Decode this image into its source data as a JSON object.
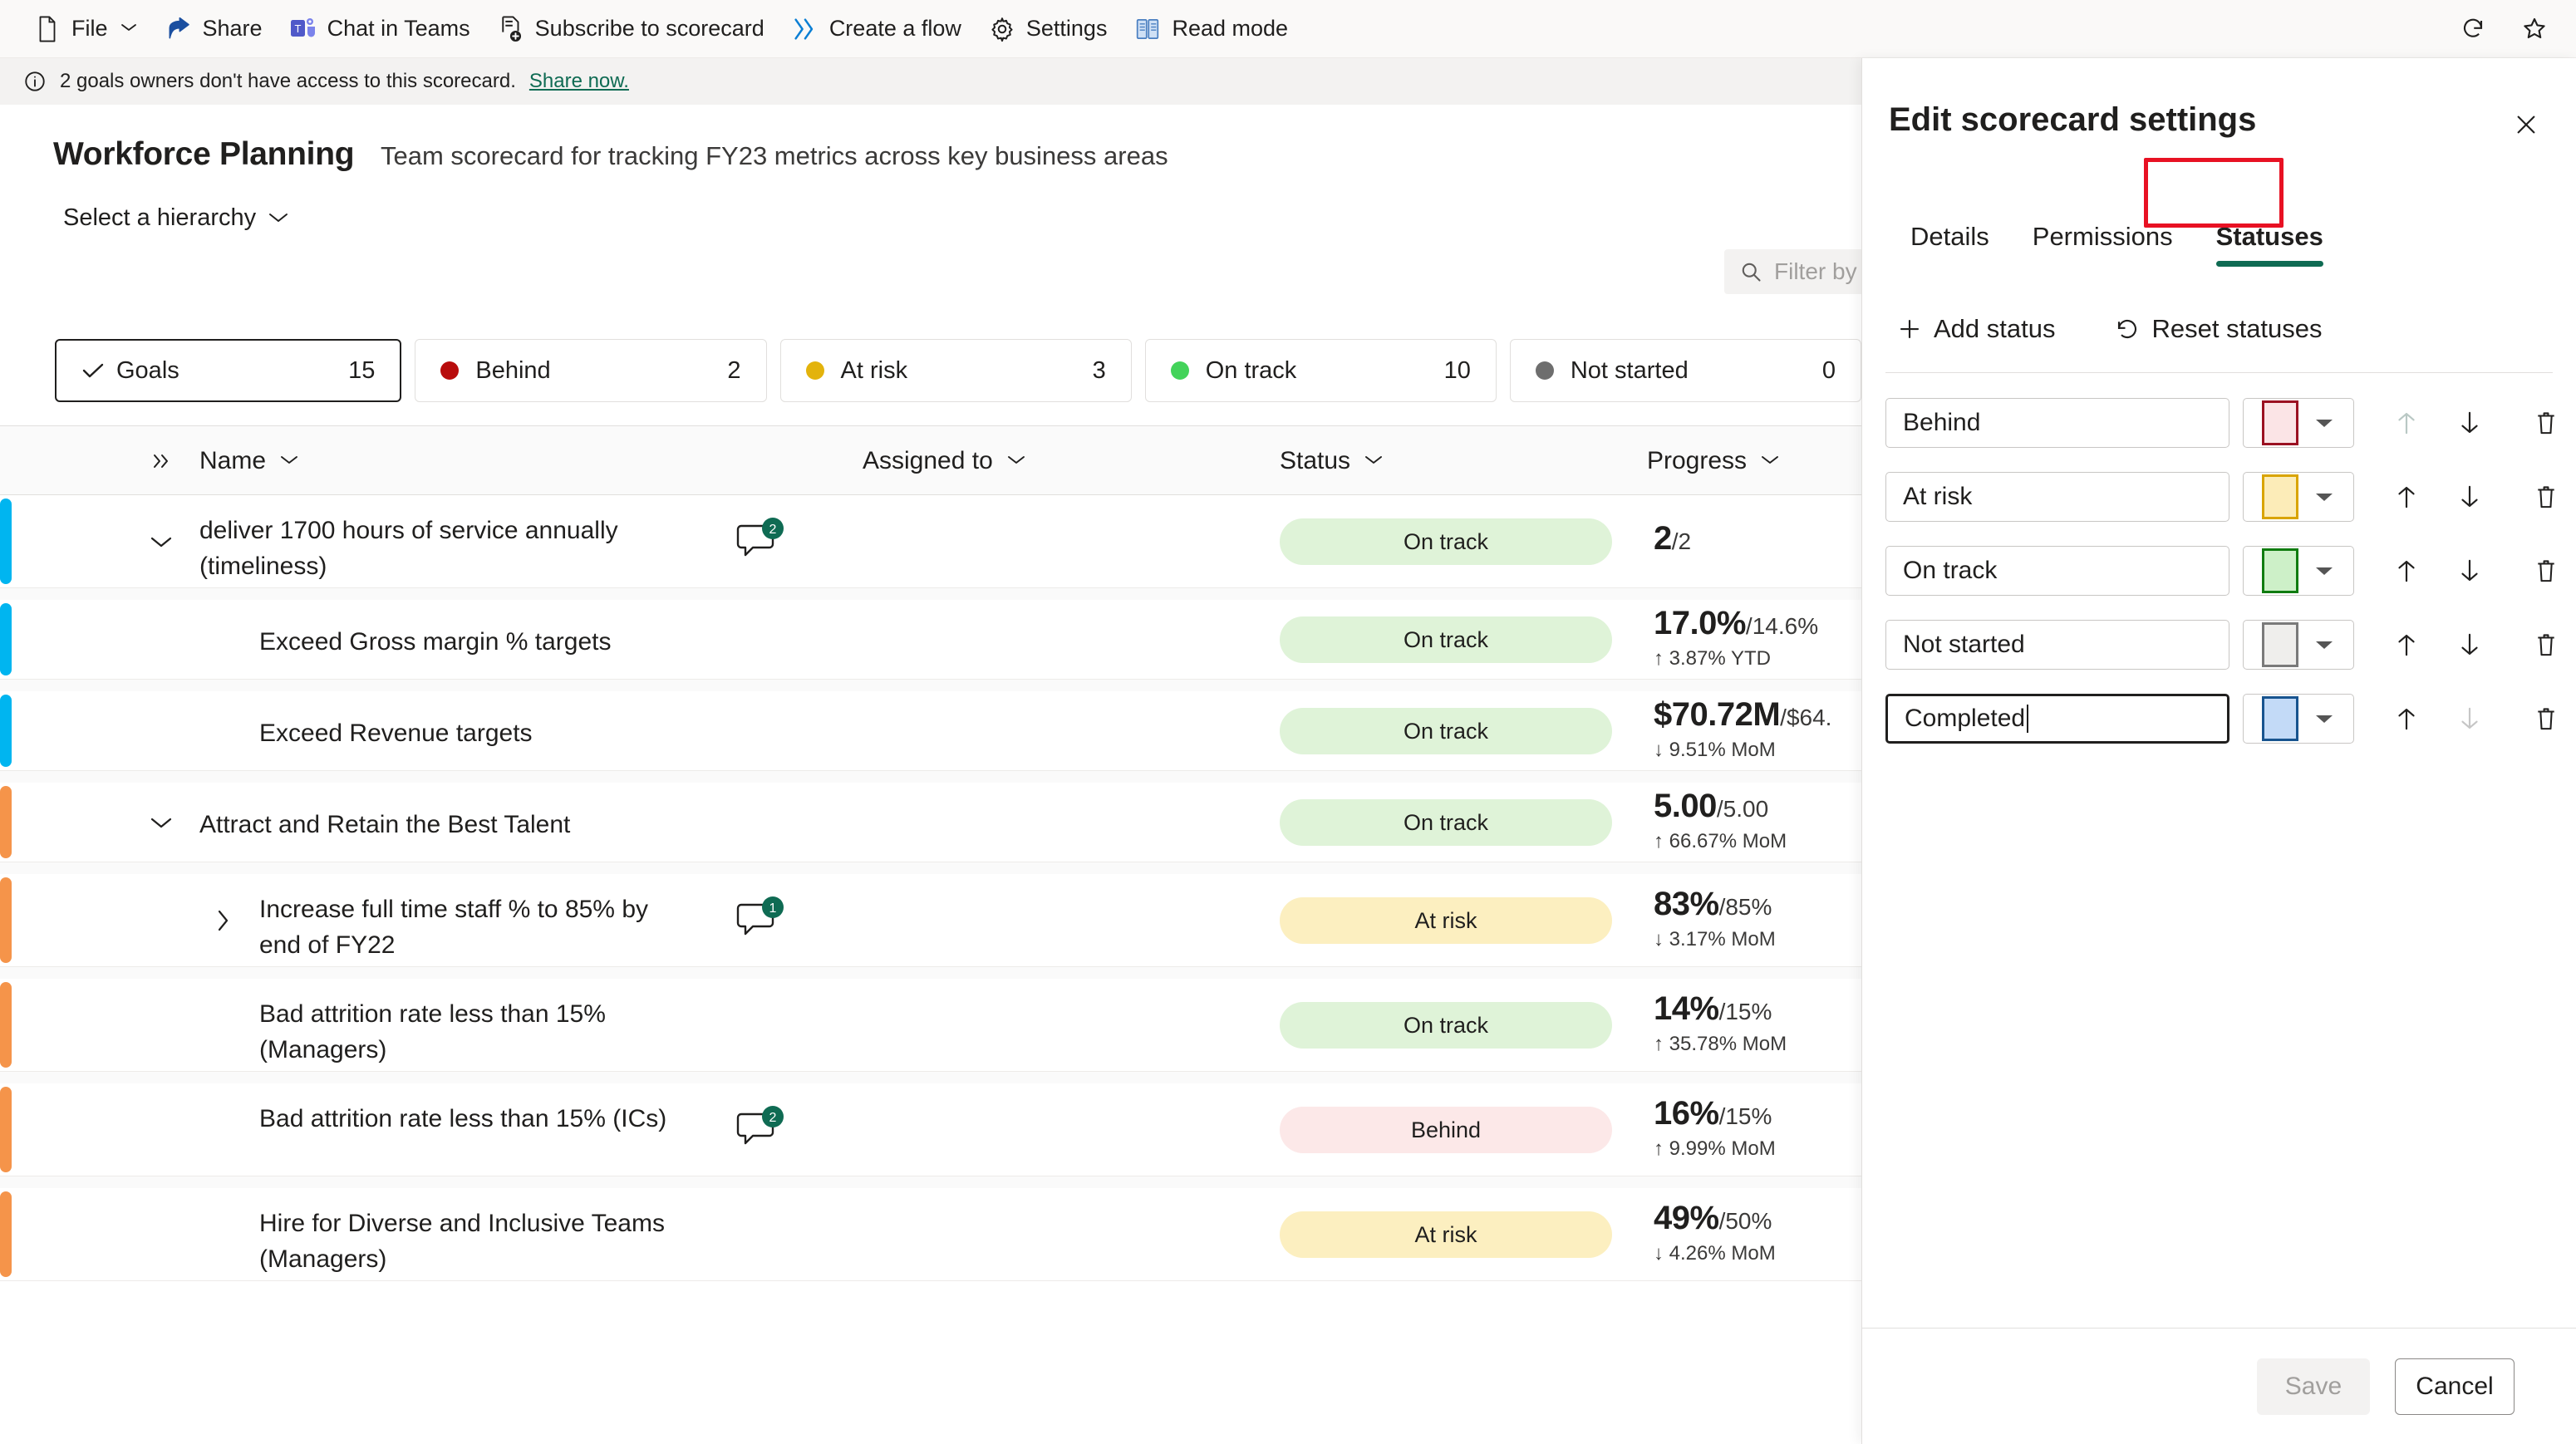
{
  "commandbar": {
    "items": [
      {
        "label": "File",
        "icon": "file-icon",
        "has_chevron": true
      },
      {
        "label": "Share",
        "icon": "share-icon",
        "has_chevron": false
      },
      {
        "label": "Chat in Teams",
        "icon": "teams-icon",
        "has_chevron": false
      },
      {
        "label": "Subscribe to scorecard",
        "icon": "subscribe-icon",
        "has_chevron": false
      },
      {
        "label": "Create a flow",
        "icon": "flow-icon",
        "has_chevron": false
      },
      {
        "label": "Settings",
        "icon": "gear-icon",
        "has_chevron": false
      },
      {
        "label": "Read mode",
        "icon": "read-mode-icon",
        "has_chevron": false
      }
    ],
    "right_icons": [
      "refresh-icon",
      "favorite-star-icon"
    ]
  },
  "notice": {
    "text": "2 goals owners don't have access to this scorecard.",
    "link": "Share now.",
    "icon": "info-icon"
  },
  "scorecard": {
    "title": "Workforce Planning",
    "description": "Team scorecard for tracking FY23 metrics across key business areas",
    "hierarchy_label": "Select a hierarchy",
    "filter_placeholder": "Filter by"
  },
  "summary_pills": [
    {
      "name": "Goals",
      "count": "15",
      "dot": "",
      "selected": true,
      "icon": "check-icon"
    },
    {
      "name": "Behind",
      "count": "2",
      "dot": "#b80c0c",
      "selected": false
    },
    {
      "name": "At risk",
      "count": "3",
      "dot": "#e3b30c",
      "selected": false
    },
    {
      "name": "On track",
      "count": "10",
      "dot": "#43d35a",
      "selected": false
    },
    {
      "name": "Not started",
      "count": "0",
      "dot": "#6e6e6e",
      "selected": false
    }
  ],
  "table": {
    "columns": [
      {
        "label": "Name",
        "sortable": true
      },
      {
        "label": "Assigned to",
        "sortable": true
      },
      {
        "label": "Status",
        "sortable": true
      },
      {
        "label": "Progress",
        "sortable": true
      }
    ],
    "rows": [
      {
        "name": "deliver 1700 hours of service annually (timeliness)",
        "accent": "#00b5f0",
        "indent": 0,
        "chevron": "down",
        "comments": "2",
        "status": {
          "label": "On track",
          "bg": "#dff3d8"
        },
        "progress_main": "2",
        "progress_sub": "/2",
        "delta": ""
      },
      {
        "name": "Exceed Gross margin % targets",
        "accent": "#00b5f0",
        "indent": 1,
        "chevron": "",
        "comments": "",
        "status": {
          "label": "On track",
          "bg": "#dff3d8"
        },
        "progress_main": "17.0%",
        "progress_sub": "/14.6%",
        "delta": "↑ 3.87% YTD"
      },
      {
        "name": "Exceed Revenue targets",
        "accent": "#00b5f0",
        "indent": 1,
        "chevron": "",
        "comments": "",
        "status": {
          "label": "On track",
          "bg": "#dff3d8"
        },
        "progress_main": "$70.72M",
        "progress_sub": "/$64.",
        "delta": "↓ 9.51% MoM"
      },
      {
        "name": "Attract and Retain the Best Talent",
        "accent": "#f5944a",
        "indent": 0,
        "chevron": "down",
        "comments": "",
        "status": {
          "label": "On track",
          "bg": "#dff3d8"
        },
        "progress_main": "5.00",
        "progress_sub": "/5.00",
        "delta": "↑ 66.67% MoM"
      },
      {
        "name": "Increase full time staff % to 85% by end of FY22",
        "accent": "#f5944a",
        "indent": 1,
        "chevron": "right",
        "comments": "1",
        "status": {
          "label": "At risk",
          "bg": "#fcefc0"
        },
        "progress_main": "83%",
        "progress_sub": "/85%",
        "delta": "↓ 3.17% MoM"
      },
      {
        "name": "Bad attrition rate less than 15% (Managers)",
        "accent": "#f5944a",
        "indent": 1,
        "chevron": "",
        "comments": "",
        "status": {
          "label": "On track",
          "bg": "#dff3d8"
        },
        "progress_main": "14%",
        "progress_sub": "/15%",
        "delta": "↑ 35.78% MoM"
      },
      {
        "name": "Bad attrition rate less than 15% (ICs)",
        "accent": "#f5944a",
        "indent": 1,
        "chevron": "",
        "comments": "2",
        "status": {
          "label": "Behind",
          "bg": "#fce8e8"
        },
        "progress_main": "16%",
        "progress_sub": "/15%",
        "delta": "↑ 9.99% MoM"
      },
      {
        "name": "Hire for Diverse and Inclusive Teams (Managers)",
        "accent": "#f5944a",
        "indent": 1,
        "chevron": "",
        "comments": "",
        "status": {
          "label": "At risk",
          "bg": "#fcefc0"
        },
        "progress_main": "49%",
        "progress_sub": "/50%",
        "delta": "↓ 4.26% MoM"
      }
    ]
  },
  "panel": {
    "title": "Edit scorecard settings",
    "tabs": [
      {
        "label": "Details",
        "active": false
      },
      {
        "label": "Permissions",
        "active": false
      },
      {
        "label": "Statuses",
        "active": true
      }
    ],
    "actions": [
      {
        "label": "Add status",
        "icon": "plus-icon"
      },
      {
        "label": "Reset statuses",
        "icon": "reset-icon"
      }
    ],
    "statuses": [
      {
        "name": "Behind",
        "fill": "#fbe4e6",
        "stroke": "#9b1122",
        "up_enabled": false,
        "down_enabled": true,
        "focused": false
      },
      {
        "name": "At risk",
        "fill": "#fcecb8",
        "stroke": "#d9a400",
        "up_enabled": true,
        "down_enabled": true,
        "focused": false
      },
      {
        "name": "On track",
        "fill": "#cdf0c8",
        "stroke": "#107c10",
        "up_enabled": true,
        "down_enabled": true,
        "focused": false
      },
      {
        "name": "Not started",
        "fill": "#efeeec",
        "stroke": "#7a7a7a",
        "up_enabled": true,
        "down_enabled": true,
        "focused": false
      },
      {
        "name": "Completed",
        "fill": "#c3daf7",
        "stroke": "#18548f",
        "up_enabled": true,
        "down_enabled": false,
        "focused": true
      }
    ],
    "save_label": "Save",
    "cancel_label": "Cancel",
    "save_enabled": false,
    "highlight_color": "#e81123",
    "accent_color": "#0f6b53"
  }
}
